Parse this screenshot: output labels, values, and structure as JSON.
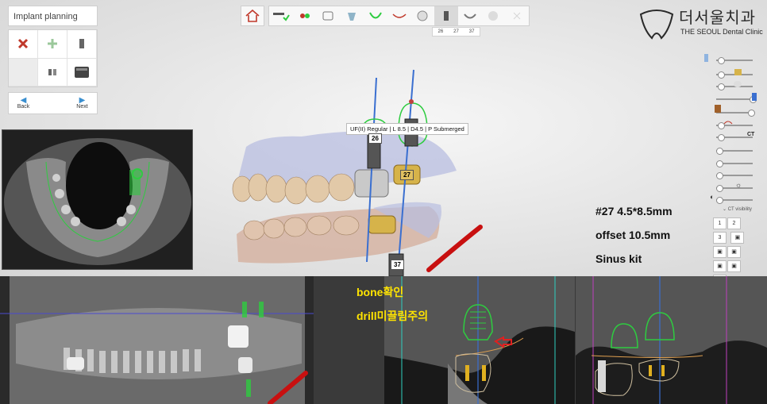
{
  "window": {
    "panel_title": "Implant planning"
  },
  "left_tools": {
    "delete_label": "",
    "back_label": "Back",
    "next_label": "Next"
  },
  "implant_tabs": [
    "26",
    "27",
    "37"
  ],
  "brand": {
    "name_ko": "더서울치과",
    "name_en": "THE SEOUL Dental Clinic"
  },
  "viewport": {
    "implant_spec_label": "UF(II) Regular | L 8.5 | D4.5 | P Submerged",
    "tooth_numbers": [
      "26",
      "27",
      "37"
    ]
  },
  "notes": {
    "line1": "#27 4.5*8.5mm",
    "line2": "offset 10.5mm",
    "line3": "Sinus kit"
  },
  "cross_section_notes": {
    "line1": "bone확인",
    "line2": "drill미끌림주의"
  },
  "right_panel": {
    "ct_label": "CT",
    "ct_visibility": "CT visibility",
    "view_numbers": [
      "1",
      "2",
      "3"
    ]
  },
  "colors": {
    "accent_blue": "#3a8fd0",
    "implant_green": "#2ecc40",
    "delete_red": "#c0392b",
    "note_yellow": "#ffe400"
  }
}
